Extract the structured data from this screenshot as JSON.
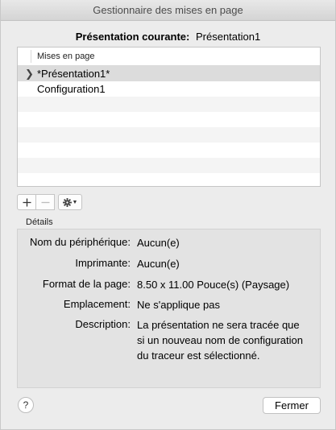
{
  "window": {
    "title": "Gestionnaire des mises en page"
  },
  "current": {
    "label": "Présentation courante:",
    "value": "Présentation1"
  },
  "table": {
    "column_header": "Mises en page",
    "rows": [
      {
        "name": "*Présentation1*",
        "selected": true
      },
      {
        "name": "Configuration1",
        "selected": false
      }
    ]
  },
  "toolbar": {
    "add_icon": "plus-icon",
    "remove_icon": "minus-icon",
    "gear_icon": "gear-icon"
  },
  "details": {
    "label": "Détails",
    "fields": [
      {
        "key": "Nom du périphérique:",
        "value": "Aucun(e)"
      },
      {
        "key": "Imprimante:",
        "value": "Aucun(e)"
      },
      {
        "key": "Format de la page:",
        "value": "8.50 x 11.00 Pouce(s) (Paysage)"
      },
      {
        "key": "Emplacement:",
        "value": "Ne s'applique pas"
      },
      {
        "key": "Description:",
        "value": "La présentation ne sera tracée que si un nouveau nom de configuration du traceur est sélectionné."
      }
    ]
  },
  "footer": {
    "help_label": "?",
    "close_label": "Fermer"
  }
}
